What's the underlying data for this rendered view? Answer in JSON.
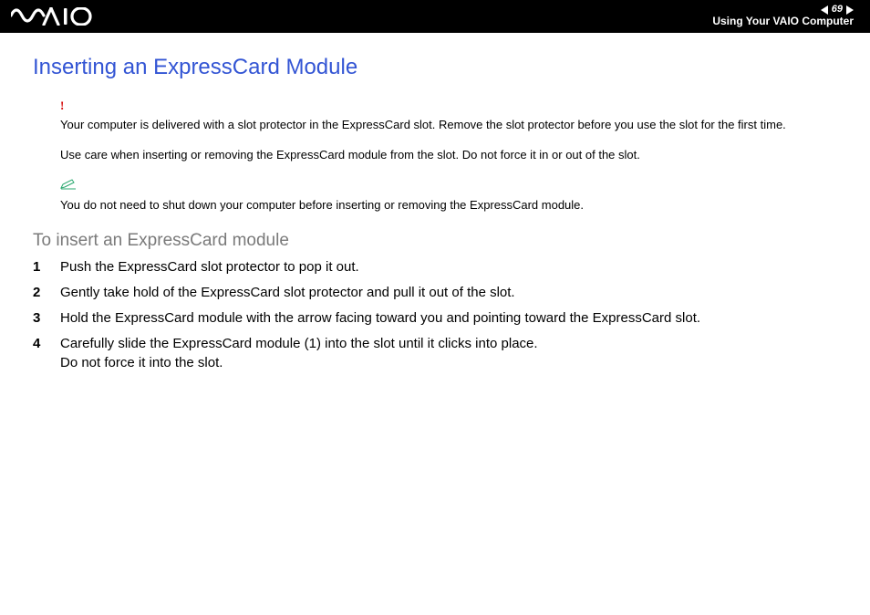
{
  "header": {
    "page_number": "69",
    "section": "Using Your VAIO Computer"
  },
  "content": {
    "title": "Inserting an ExpressCard Module",
    "warning_line1": "Your computer is delivered with a slot protector in the ExpressCard slot. Remove the slot protector before you use the slot for the first time.",
    "warning_line2": "Use care when inserting or removing the ExpressCard module from the slot. Do not force it in or out of the slot.",
    "note_line": "You do not need to shut down your computer before inserting or removing the ExpressCard module.",
    "subhead": "To insert an ExpressCard module",
    "steps": [
      {
        "num": "1",
        "text": "Push the ExpressCard slot protector to pop it out."
      },
      {
        "num": "2",
        "text": "Gently take hold of the ExpressCard slot protector and pull it out of the slot."
      },
      {
        "num": "3",
        "text": "Hold the ExpressCard module with the arrow facing toward you and pointing toward the ExpressCard slot."
      },
      {
        "num": "4",
        "text": "Carefully slide the ExpressCard module (1) into the slot until it clicks into place.\nDo not force it into the slot."
      }
    ]
  }
}
